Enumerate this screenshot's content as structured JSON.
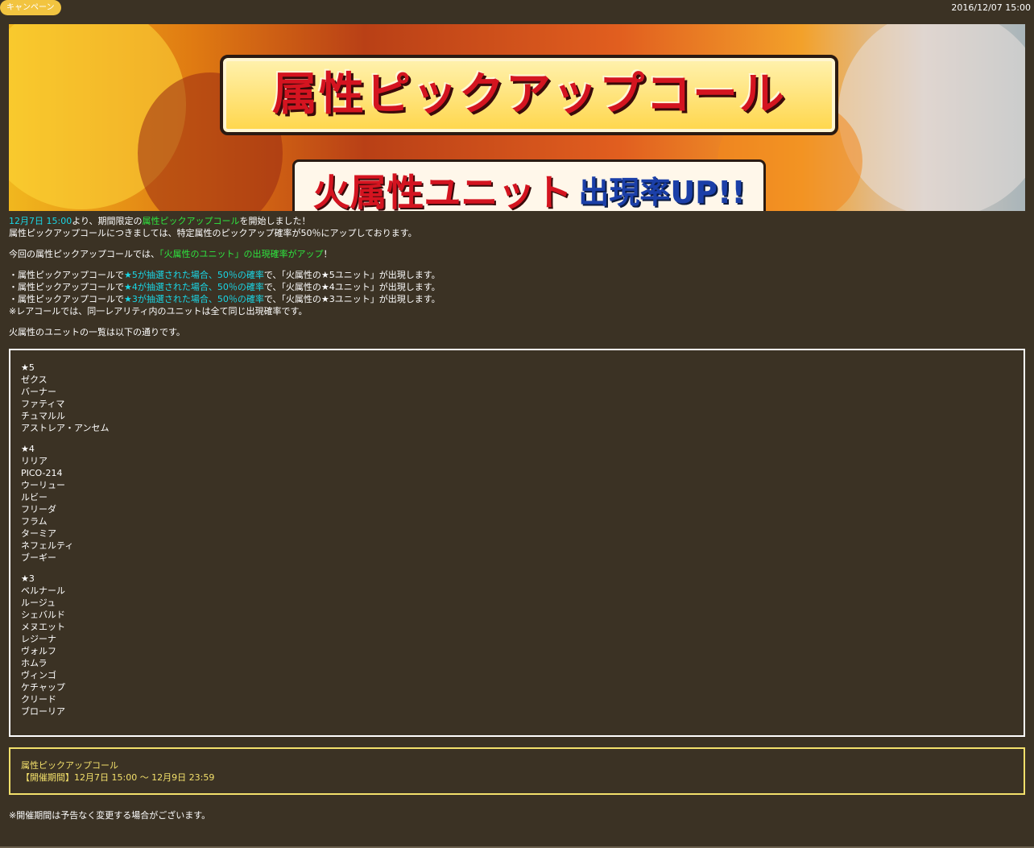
{
  "header": {
    "badge": "キャンペーン",
    "date": "2016/12/07 15:00"
  },
  "banner": {
    "title": "属性ピックアップコール",
    "sub_red": "火属性ユニット",
    "sub_blue": "出現率UP!!"
  },
  "intro": {
    "line1_date": "12月7日 15:00",
    "line1_a": "より、期間限定の",
    "line1_link": "属性ピックアップコール",
    "line1_b": "を開始しました！",
    "line2": "属性ピックアップコールにつきましては、特定属性のピックアップ確率が50％にアップしております。",
    "line3_a": "今回の属性ピックアップコールでは、",
    "line3_highlight": "「火属性のユニット」の出現確率がアップ",
    "line3_b": "！"
  },
  "rates": [
    {
      "prefix": "・属性ピックアップコールで",
      "highlight": "★5が抽選された場合、50％の確率",
      "suffix": "で、「火属性の★5ユニット」が出現します。"
    },
    {
      "prefix": "・属性ピックアップコールで",
      "highlight": "★4が抽選された場合、50％の確率",
      "suffix": "で、「火属性の★4ユニット」が出現します。"
    },
    {
      "prefix": "・属性ピックアップコールで",
      "highlight": "★3が抽選された場合、50％の確率",
      "suffix": "で、「火属性の★3ユニット」が出現します。"
    }
  ],
  "rates_note": "※レアコールでは、同一レアリティ内のユニットは全て同じ出現確率です。",
  "list_intro": "火属性のユニットの一覧は以下の通りです。",
  "unit_groups": [
    {
      "rarity": "★5",
      "units": [
        "ゼクス",
        "バーナー",
        "ファティマ",
        "チュマルル",
        "アストレア・アンセム"
      ]
    },
    {
      "rarity": "★4",
      "units": [
        "リリア",
        "PICO-214",
        "ウーリュー",
        "ルビー",
        "フリーダ",
        "フラム",
        "ターミア",
        "ネフェルティ",
        "ブーギー"
      ]
    },
    {
      "rarity": "★3",
      "units": [
        "ベルナール",
        "ルージュ",
        "シェバルド",
        "メヌエット",
        "レジーナ",
        "ヴォルフ",
        "ホムラ",
        "ヴィンゴ",
        "ケチャップ",
        "クリード",
        "ブローリア"
      ]
    }
  ],
  "period_box": {
    "title": "属性ピックアップコール",
    "period": "【開催期間】12月7日 15:00 ～ 12月9日 23:59"
  },
  "footer_note": "※開催期間は予告なく変更する場合がございます。",
  "colors": {
    "background": "#3b3224",
    "badge": "#f2c440",
    "cyan": "#19d6e6",
    "green": "#2ee63f",
    "period_border": "#f3e06b"
  }
}
